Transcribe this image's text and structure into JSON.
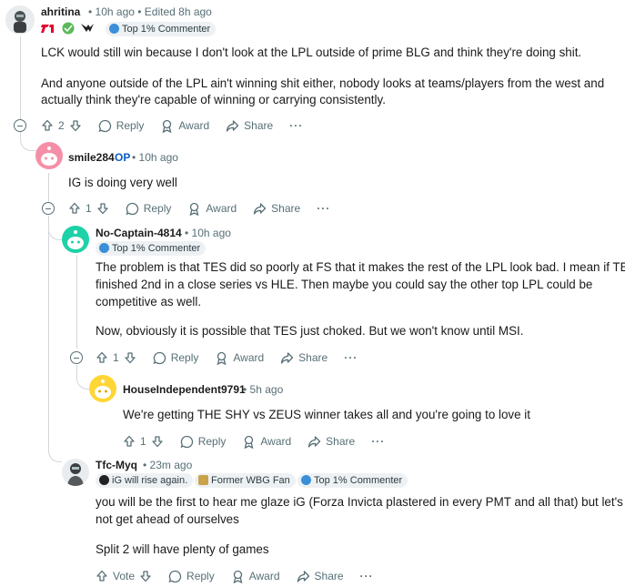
{
  "comments": [
    {
      "username": "ahritina",
      "meta": "10h ago • Edited 8h ago",
      "flair": "Top 1% Commenter",
      "flair_icons": [
        "T1",
        "WBG",
        "LGD"
      ],
      "body": [
        "LCK would still win because I don't look at the LPL outside of prime BLG and think they're doing shit.",
        "And anyone outside of the LPL ain't winning shit either, nobody looks at teams/players from the west and",
        "actually think they're capable of winning or carrying consistently."
      ],
      "votes": "2"
    },
    {
      "username": "smile284",
      "op": "OP",
      "meta": "10h ago",
      "body": [
        "IG is doing very well"
      ],
      "votes": "1"
    },
    {
      "username": "No-Captain-4814",
      "meta": "10h ago",
      "flair": "Top 1% Commenter",
      "body": [
        "The problem is that TES did so poorly at FS that it makes the rest of the LPL look bad. I mean if TES",
        "finished 2nd in a close series vs HLE. Then maybe you could say the other top LPL could be",
        "competitive as well.",
        "Now, obviously it is possible that TES just choked. But we won't know until MSI."
      ],
      "votes": "1"
    },
    {
      "username": "HouseIndependent9791",
      "meta": "5h ago",
      "body": [
        "We're getting THE SHY vs ZEUS winner takes all and you're going to love it"
      ],
      "votes": "1"
    },
    {
      "username": "Tfc-Myq",
      "meta": "23m ago",
      "flairs": [
        "iG will rise again.",
        "Former WBG Fan",
        "Top 1% Commenter"
      ],
      "body": [
        "you will be the first to hear me glaze iG (Forza Invicta plastered in every PMT and all that) but let's",
        "not get ahead of ourselves",
        "Split 2 will have plenty of games"
      ],
      "votes": "Vote"
    }
  ],
  "actions": {
    "reply": "Reply",
    "award": "Award",
    "share": "Share",
    "more": "···"
  },
  "colors": {
    "meta": "#576f76",
    "op": "#0a5cc4",
    "flair_bg": "#eef1f3",
    "thread": "#d3d7d9"
  }
}
